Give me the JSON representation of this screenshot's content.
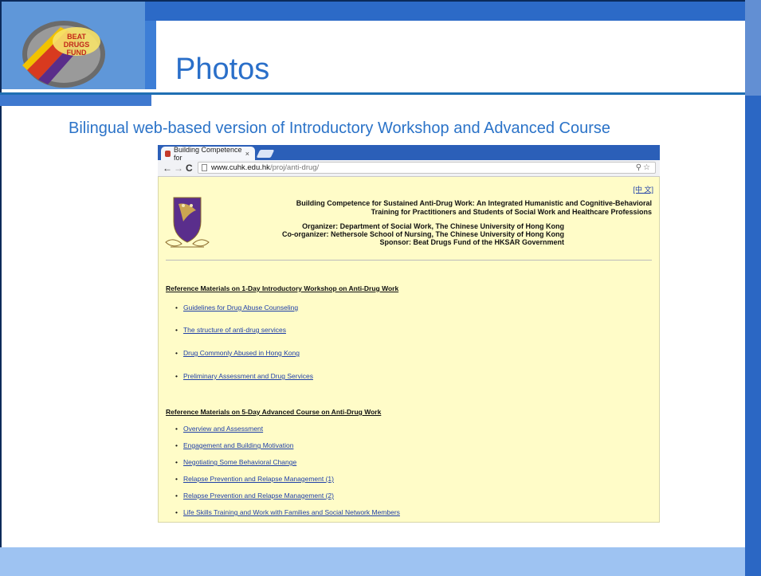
{
  "slide": {
    "title": "Photos",
    "subtitle": "Bilingual web-based version of Introductory Workshop and Advanced Course",
    "logo_text": "BEAT DRUGS FUND"
  },
  "browser": {
    "tab_title": "Building Competence for",
    "tab_close": "×",
    "url_host": "www.cuhk.edu.hk",
    "url_path": "/proj/anti-drug/",
    "nav": {
      "back": "←",
      "forward": "→",
      "reload": "C"
    },
    "omnibox_right": "⚲☆"
  },
  "page": {
    "lang_link": "[中 文]",
    "project_title_line1": "Building Competence for Sustained Anti-Drug Work: An Integrated Humanistic and Cognitive-Behavioral",
    "project_title_line2": "Training for Practitioners and Students of Social Work and Healthcare Professions",
    "organizer": "Organizer: Department of Social Work, The Chinese University of Hong Kong",
    "co_organizer": "Co-organizer: Nethersole School of Nursing, The Chinese University of Hong Kong",
    "sponsor": "Sponsor: Beat Drugs Fund of the HKSAR Government",
    "section1": {
      "title": "Reference Materials on 1-Day Introductory Workshop on Anti-Drug Work",
      "items": [
        "Guidelines for Drug Abuse Counseling",
        "The structure of anti-drug services",
        "Drug Commonly Abused in Hong Kong",
        "Preliminary Assessment and Drug Services"
      ]
    },
    "section2": {
      "title": "Reference Materials on 5-Day Advanced Course on Anti-Drug Work",
      "items": [
        "Overview and Assessment",
        "Engagement and Building Motivation",
        "Negotiating Some Behavioral Change",
        "Relapse Prevention and Relapse Management (1)",
        "Relapse Prevention and Relapse Management (2)",
        "Life Skills Training and Work with Families and Social Network Members"
      ]
    }
  },
  "colors": {
    "title_blue": "#2a6fc9",
    "band_blue": "#2b67c4",
    "page_yellow": "#fffcc8",
    "link_blue": "#1f3fa8"
  }
}
